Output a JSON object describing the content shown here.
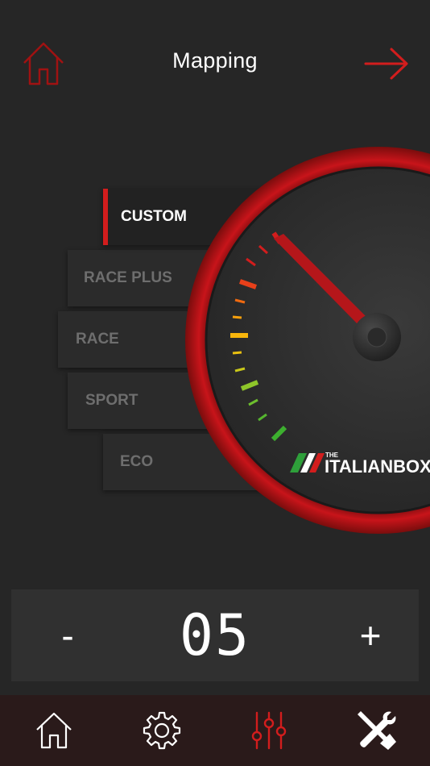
{
  "header": {
    "title": "Mapping",
    "home_icon": "home-icon",
    "next_icon": "arrow-right-icon"
  },
  "modes": {
    "items": [
      {
        "label": "CUSTOM",
        "active": true
      },
      {
        "label": "RACE PLUS",
        "active": false
      },
      {
        "label": "RACE",
        "active": false
      },
      {
        "label": "SPORT",
        "active": false
      },
      {
        "label": "ECO",
        "active": false
      }
    ]
  },
  "gauge": {
    "brand_small": "THE",
    "brand_large": "ITALIANBOX"
  },
  "value_control": {
    "minus_label": "-",
    "value": "05",
    "plus_label": "+"
  },
  "tabbar": {
    "tabs": [
      {
        "icon": "home-icon"
      },
      {
        "icon": "gear-icon"
      },
      {
        "icon": "sliders-icon",
        "active": true
      },
      {
        "icon": "tools-icon"
      }
    ]
  },
  "colors": {
    "background": "#262626",
    "accent": "#d21d1d",
    "tabbar_bg": "#2a1a1a",
    "panel_bg": "#303030"
  }
}
